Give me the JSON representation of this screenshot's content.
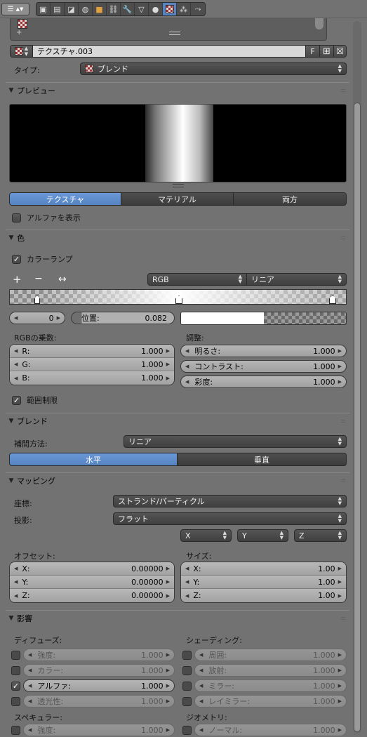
{
  "header": {
    "editor_menu_icon": "properties-editor-icon",
    "context_icons": [
      "render-icon",
      "render-layers-icon",
      "scene-icon",
      "world-icon",
      "object-icon",
      "constraints-icon",
      "modifiers-icon",
      "data-icon",
      "material-icon",
      "texture-icon",
      "particles-icon",
      "physics-icon"
    ],
    "active_context": "texture-icon"
  },
  "texture_slot": {
    "add_label": "+",
    "name": "テクスチャ.003",
    "fake_user_label": "F"
  },
  "type_row": {
    "label": "タイプ:",
    "value": "ブレンド"
  },
  "preview_panel": {
    "title": "プレビュー",
    "tabs": [
      "テクスチャ",
      "マテリアル",
      "両方"
    ],
    "active_tab": 0,
    "show_alpha_label": "アルファを表示",
    "show_alpha_checked": false
  },
  "color_panel": {
    "title": "色",
    "color_ramp_label": "カラーランプ",
    "color_ramp_checked": true,
    "add_label": "+",
    "remove_label": "−",
    "flip_label": "↔",
    "color_mode": "RGB",
    "interpolation": "リニア",
    "active_index": "0",
    "position_label": "位置:",
    "position_value": "0.082",
    "rgb_multiply_label": "RGBの乗数:",
    "r_label": "R:",
    "r_value": "1.000",
    "g_label": "G:",
    "g_value": "1.000",
    "b_label": "B:",
    "b_value": "1.000",
    "adjust_label": "調整:",
    "brightness_label": "明るさ:",
    "brightness_value": "1.000",
    "contrast_label": "コントラスト:",
    "contrast_value": "1.000",
    "saturation_label": "彩度:",
    "saturation_value": "1.000",
    "clamp_label": "範囲制限",
    "clamp_checked": true
  },
  "blend_panel": {
    "title": "ブレンド",
    "progression_label": "補間方法:",
    "progression_value": "リニア",
    "orientation": [
      "水平",
      "垂直"
    ],
    "active_orientation": 0
  },
  "mapping_panel": {
    "title": "マッピング",
    "coords_label": "座標:",
    "coords_value": "ストランド/パーティクル",
    "projection_label": "投影:",
    "projection_value": "フラット",
    "axis_x": "X",
    "axis_y": "Y",
    "axis_z": "Z",
    "offset_label": "オフセット:",
    "offset": [
      {
        "label": "X:",
        "value": "0.00000"
      },
      {
        "label": "Y:",
        "value": "0.00000"
      },
      {
        "label": "Z:",
        "value": "0.00000"
      }
    ],
    "size_label": "サイズ:",
    "size": [
      {
        "label": "X:",
        "value": "1.00"
      },
      {
        "label": "Y:",
        "value": "1.00"
      },
      {
        "label": "Z:",
        "value": "1.00"
      }
    ]
  },
  "influence_panel": {
    "title": "影響",
    "diffuse_label": "ディフューズ:",
    "diffuse": [
      {
        "label": "強度:",
        "value": "1.000",
        "checked": false
      },
      {
        "label": "カラー:",
        "value": "1.000",
        "checked": false
      },
      {
        "label": "アルファ:",
        "value": "1.000",
        "checked": true
      },
      {
        "label": "透光性:",
        "value": "1.000",
        "checked": false
      }
    ],
    "shading_label": "シェーディング:",
    "shading": [
      {
        "label": "周囲:",
        "value": "1.000",
        "checked": false
      },
      {
        "label": "放射:",
        "value": "1.000",
        "checked": false
      },
      {
        "label": "ミラー:",
        "value": "1.000",
        "checked": false
      },
      {
        "label": "レイミラー:",
        "value": "1.000",
        "checked": false
      }
    ],
    "specular_label": "スペキュラー:",
    "specular": [
      {
        "label": "強度:",
        "value": "1.000",
        "checked": false
      }
    ],
    "geometry_label": "ジオメトリ:",
    "geometry": [
      {
        "label": "ノーマル:",
        "value": "1.000",
        "checked": false
      }
    ]
  },
  "colors": {
    "panel_bg": "#727272",
    "active_blue": "#5683c0"
  }
}
